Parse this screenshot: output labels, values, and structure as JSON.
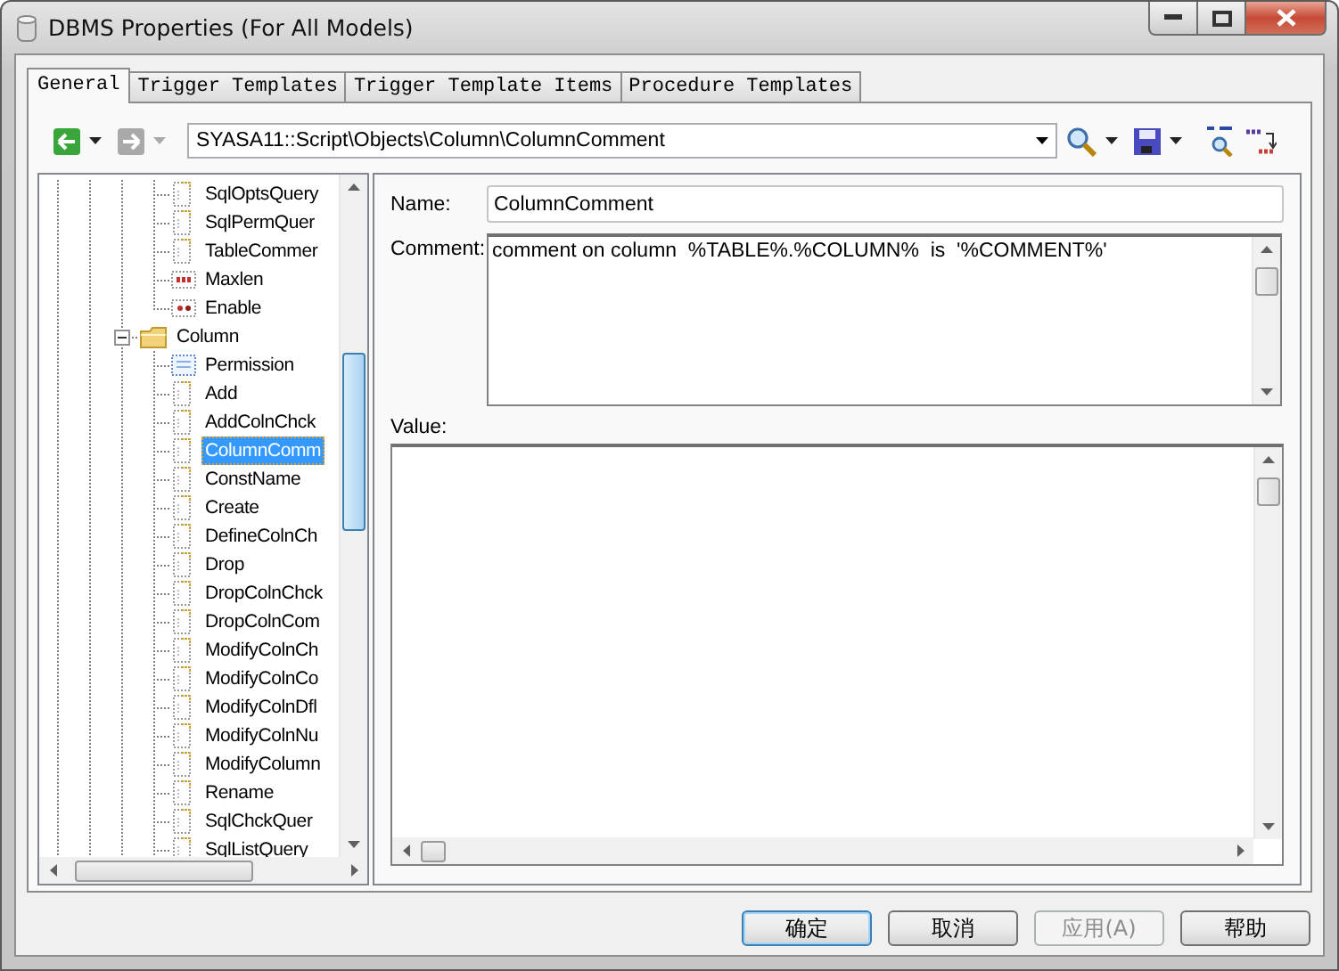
{
  "window": {
    "title": "DBMS Properties (For All Models)"
  },
  "tabs": [
    {
      "label": "General",
      "selected": true
    },
    {
      "label": "Trigger Templates",
      "selected": false
    },
    {
      "label": "Trigger Template Items",
      "selected": false
    },
    {
      "label": "Procedure Templates",
      "selected": false
    }
  ],
  "toolbar": {
    "path": "SYASA11::Script\\Objects\\Column\\ColumnComment"
  },
  "tree": {
    "previous_folder_children": [
      {
        "label": "SqlOptsQuery",
        "kind": "script",
        "selected": false
      },
      {
        "label": "SqlPermQuer",
        "kind": "script",
        "selected": false
      },
      {
        "label": "TableCommer",
        "kind": "script",
        "selected": false
      },
      {
        "label": "Maxlen",
        "kind": "number",
        "selected": false
      },
      {
        "label": "Enable",
        "kind": "boolean",
        "selected": false
      }
    ],
    "items": [
      {
        "label": "Column",
        "kind": "folder",
        "expanded": true,
        "selected": false,
        "children": [
          {
            "label": "Permission",
            "kind": "list",
            "selected": false
          },
          {
            "label": "Add",
            "kind": "script",
            "selected": false
          },
          {
            "label": "AddColnChck",
            "kind": "script",
            "selected": false
          },
          {
            "label": "ColumnComm",
            "kind": "script",
            "selected": true
          },
          {
            "label": "ConstName",
            "kind": "script",
            "selected": false
          },
          {
            "label": "Create",
            "kind": "script",
            "selected": false
          },
          {
            "label": "DefineColnCh",
            "kind": "script",
            "selected": false
          },
          {
            "label": "Drop",
            "kind": "script",
            "selected": false
          },
          {
            "label": "DropColnChck",
            "kind": "script",
            "selected": false
          },
          {
            "label": "DropColnCom",
            "kind": "script",
            "selected": false
          },
          {
            "label": "ModifyColnCh",
            "kind": "script",
            "selected": false
          },
          {
            "label": "ModifyColnCo",
            "kind": "script",
            "selected": false
          },
          {
            "label": "ModifyColnDfl",
            "kind": "script",
            "selected": false
          },
          {
            "label": "ModifyColnNu",
            "kind": "script",
            "selected": false
          },
          {
            "label": "ModifyColumn",
            "kind": "script",
            "selected": false
          },
          {
            "label": "Rename",
            "kind": "script",
            "selected": false
          },
          {
            "label": "SqlChckQuer",
            "kind": "script",
            "selected": false
          },
          {
            "label": "SqlListQuery",
            "kind": "script",
            "selected": false
          }
        ]
      }
    ]
  },
  "fields": {
    "name": {
      "label": "Name:",
      "value": "ColumnComment"
    },
    "comment": {
      "label": "Comment:",
      "value": "comment on column  %TABLE%.%COLUMN%  is  '%COMMENT%'"
    },
    "value": {
      "label": "Value:"
    }
  },
  "buttons": [
    {
      "label": "确定",
      "default": true,
      "disabled": false
    },
    {
      "label": "取消",
      "default": false,
      "disabled": false
    },
    {
      "label": "应用(A)",
      "default": false,
      "disabled": true
    },
    {
      "label": "帮助",
      "default": false,
      "disabled": false
    }
  ]
}
